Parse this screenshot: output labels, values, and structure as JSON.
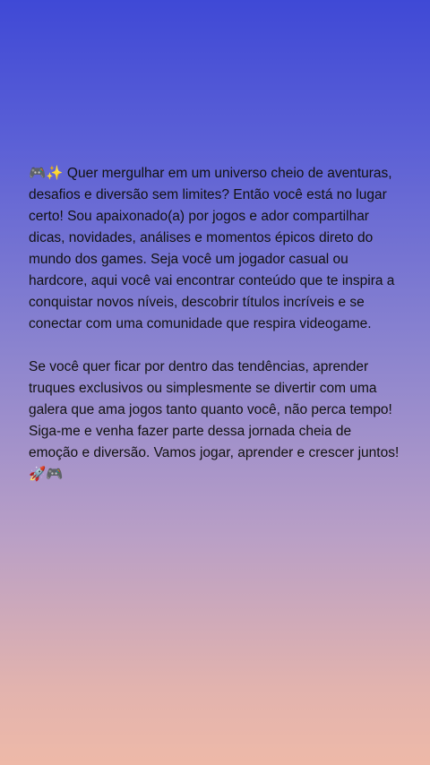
{
  "post": {
    "paragraphs": [
      "🎮✨ Quer mergulhar em um universo cheio de aventuras, desafios e diversão sem limites? Então você está no lugar certo! Sou apaixonado(a) por jogos e ador compartilhar dicas, novidades, análises e momentos épicos direto do mundo dos games. Seja você um jogador casual ou hardcore, aqui você vai encontrar conteúdo que te inspira a conquistar novos níveis, descobrir títulos incríveis e se conectar com uma comunidade que respira videogame.",
      "Se você quer ficar por dentro das tendências, aprender truques exclusivos ou simplesmente se divertir com uma galera que ama jogos tanto quanto você, não perca tempo! Siga-me e venha fazer parte dessa jornada cheia de emoção e diversão. Vamos jogar, aprender e crescer juntos! 🚀🎮"
    ]
  },
  "background": {
    "gradient_top": "#3f49d6",
    "gradient_bottom": "#eeb9a8"
  }
}
